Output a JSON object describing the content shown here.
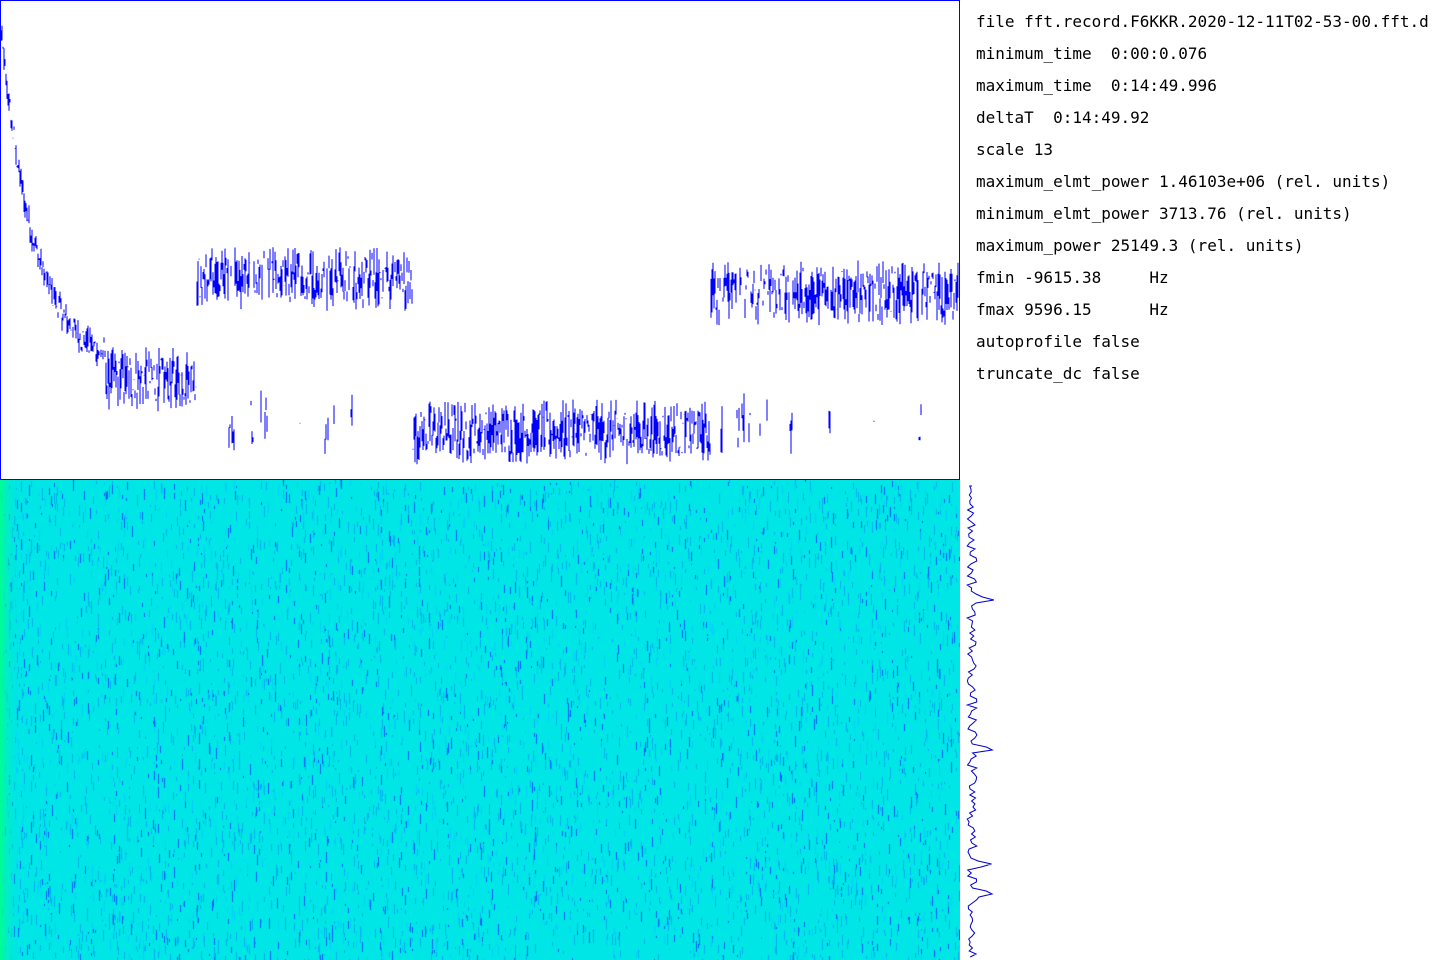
{
  "info": {
    "lines": [
      "file fft.record.F6KKR.2020-12-11T02-53-00.fft.d",
      "minimum_time  0:00:0.076",
      "maximum_time  0:14:49.996",
      "deltaT  0:14:49.92",
      "scale 13",
      "maximum_elmt_power 1.46103e+06 (rel. units)",
      "minimum_elmt_power 3713.76 (rel. units)",
      "maximum_power 25149.3 (rel. units)",
      "fmin -9615.38     Hz",
      "fmax 9596.15      Hz",
      "autoprofile false",
      "truncate_dc false"
    ]
  },
  "chart_data": [
    {
      "type": "line",
      "description_role": "time power profile",
      "x_range": [
        0,
        1
      ],
      "y_range": [
        0,
        1
      ],
      "segments": [
        {
          "from": 0.0,
          "to": 0.11,
          "level": "decay"
        },
        {
          "from": 0.11,
          "to": 0.205,
          "level": 0.21
        },
        {
          "from": 0.205,
          "to": 0.43,
          "level": 0.42,
          "dropouts": true
        },
        {
          "from": 0.43,
          "to": 0.74,
          "level": 0.1
        },
        {
          "from": 0.74,
          "to": 1.0,
          "level": 0.39,
          "dropouts": true
        }
      ],
      "colors": {
        "line": "#0000ff",
        "frame": "#0000ff"
      }
    },
    {
      "type": "heatmap",
      "description_role": "waterfall spectrogram",
      "colors": {
        "base": "#00e5e5",
        "mid": "#00b0f0",
        "low": "#0060ff",
        "edge": "#00ff90"
      }
    },
    {
      "type": "line",
      "description_role": "frequency profile",
      "peaks": [
        0.25,
        0.56,
        0.8,
        0.86
      ],
      "colors": {
        "line": "#0000cc"
      }
    }
  ]
}
